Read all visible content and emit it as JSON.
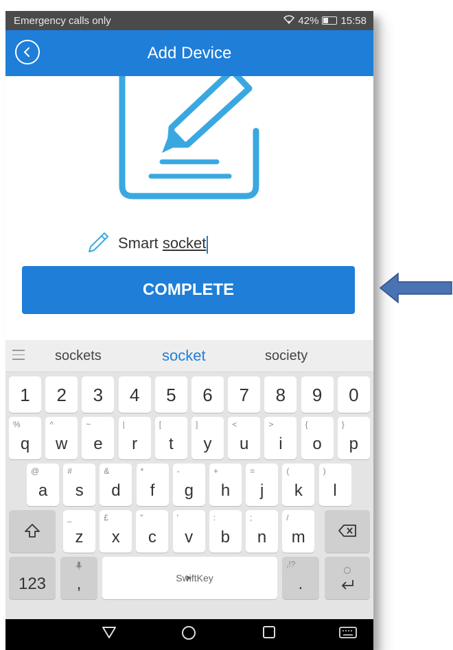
{
  "status": {
    "carrier": "Emergency calls only",
    "battery": "42%",
    "time": "15:58",
    "battery_level": 0.42
  },
  "header": {
    "title": "Add Device"
  },
  "name": {
    "prefix": "Smart",
    "word": "socket"
  },
  "complete_label": "COMPLETE",
  "keyboard": {
    "suggestions": [
      "sockets",
      "socket",
      "society"
    ],
    "numbers": [
      "1",
      "2",
      "3",
      "4",
      "5",
      "6",
      "7",
      "8",
      "9",
      "0"
    ],
    "row1": [
      [
        "q",
        "%"
      ],
      [
        "w",
        "^"
      ],
      [
        "e",
        "~"
      ],
      [
        "r",
        "|"
      ],
      [
        "t",
        "["
      ],
      [
        "y",
        "]"
      ],
      [
        "u",
        "<"
      ],
      [
        "i",
        ">"
      ],
      [
        "o",
        "{"
      ],
      [
        "p",
        "}"
      ]
    ],
    "row2": [
      [
        "a",
        "@"
      ],
      [
        "s",
        "#"
      ],
      [
        "d",
        "&"
      ],
      [
        "f",
        "*"
      ],
      [
        "g",
        "-"
      ],
      [
        "h",
        "+"
      ],
      [
        "j",
        "="
      ],
      [
        "k",
        "("
      ],
      [
        "l",
        ")"
      ]
    ],
    "row3": [
      [
        "z",
        "_"
      ],
      [
        "x",
        "£"
      ],
      [
        "c",
        "\""
      ],
      [
        "v",
        "'"
      ],
      [
        "b",
        ":"
      ],
      [
        "n",
        ";"
      ],
      [
        "m",
        "/"
      ]
    ],
    "symbols_key": "123",
    "comma": ",",
    "period": ".",
    "period_alt": ",!?",
    "space_brand": "SwiftKey"
  },
  "colors": {
    "accent": "#1e7ed8",
    "illustration": "#3aa8e0"
  }
}
